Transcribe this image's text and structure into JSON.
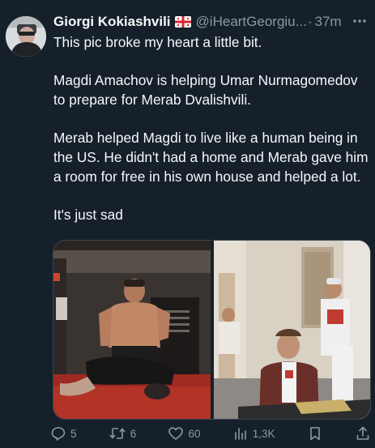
{
  "author": {
    "display_name": "Giorgi Kokiashvili",
    "flag_icon": "georgia-flag-emoji",
    "handle": "@iHeartGeorgiu...",
    "separator": "·",
    "timestamp": "37m"
  },
  "tweet": {
    "paragraphs": [
      "This pic broke my heart a little bit.",
      "Magdi Amachov is helping Umar Nurmagomedov to prepare for Merab Dvalishvili.",
      "Merab helped Magdi to live like a human being in the US. He didn't had a home and Merab gave him a room for free in his own house and helped a lot.",
      "It's just sad"
    ]
  },
  "media": {
    "images": [
      {
        "icon": "photo-gym-training"
      },
      {
        "icon": "photo-signing-table"
      }
    ]
  },
  "actions": {
    "reply_count": "5",
    "retweet_count": "6",
    "like_count": "60",
    "views_count": "1,3K"
  },
  "colors": {
    "background": "#15202b",
    "text": "#f7f9f9",
    "secondary": "#8b98a5",
    "border": "#38444d"
  }
}
